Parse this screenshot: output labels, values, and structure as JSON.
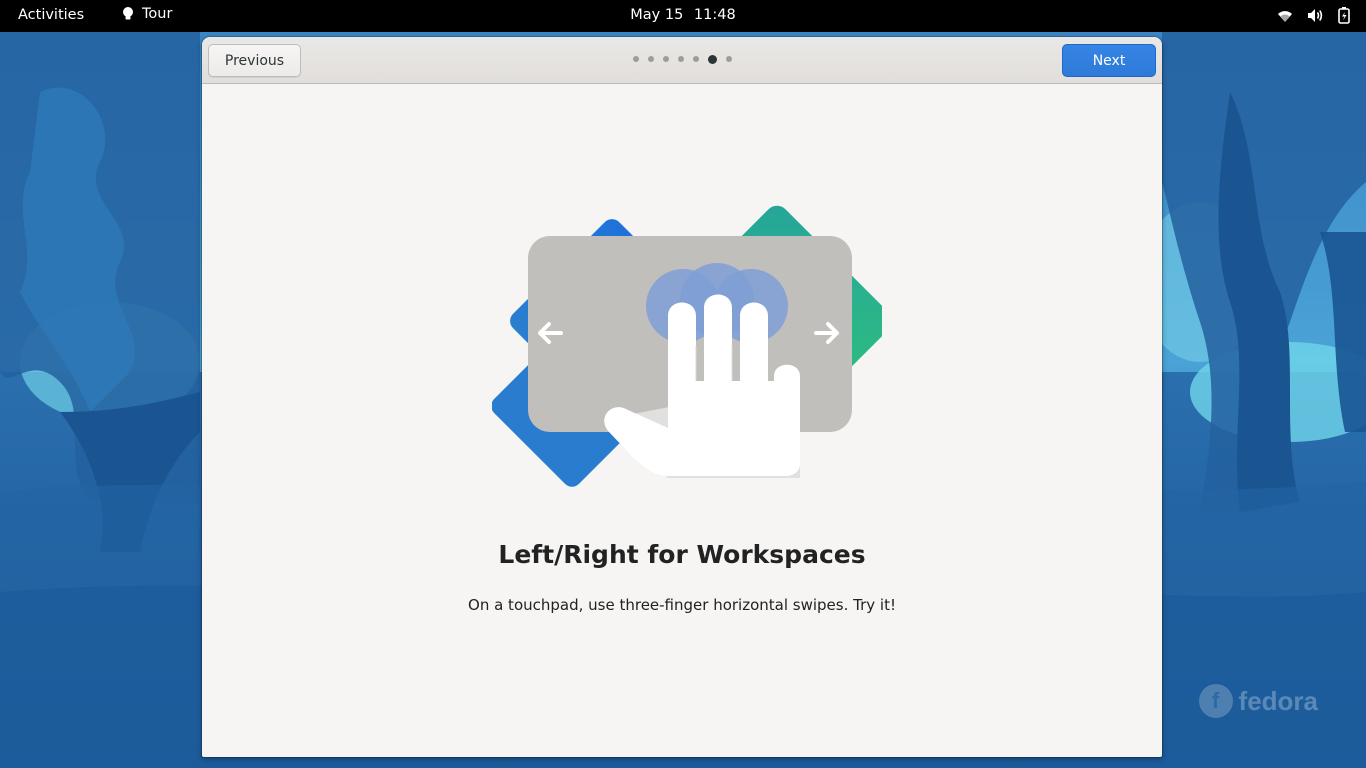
{
  "topbar": {
    "activities_label": "Activities",
    "app_name": "Tour",
    "date": "May 15",
    "time": "11:48",
    "status_icons": [
      "wifi-icon",
      "volume-icon",
      "battery-icon"
    ]
  },
  "desktop": {
    "watermark": "fedora"
  },
  "tour": {
    "previous_label": "Previous",
    "next_label": "Next",
    "page_count": 7,
    "current_page": 6,
    "title": "Left/Right for Workspaces",
    "description": "On a touchpad, use three-finger horizontal swipes. Try it!",
    "illustration": "three-finger-swipe-illustration"
  },
  "colors": {
    "accent": "#3584e4",
    "window_bg": "#f6f5f4",
    "topbar_bg": "#000000"
  }
}
